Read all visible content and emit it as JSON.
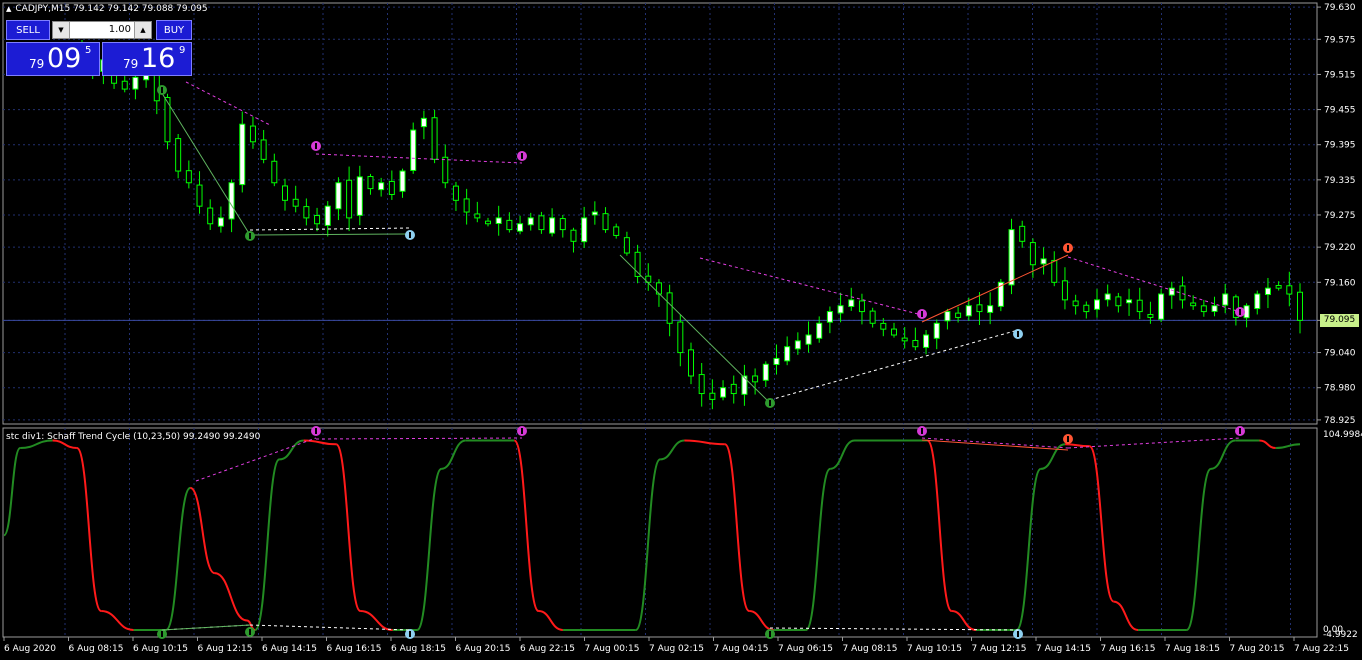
{
  "symbol_header": "CADJPY,M15  79.142 79.142 79.088 79.095",
  "indicator_header": "stc div1: Schaff Trend Cycle (10,23,50) 99.2490 99.2490",
  "trade_panel": {
    "sell_label": "SELL",
    "buy_label": "BUY",
    "lot_value": "1.00",
    "bid_prefix": "79",
    "bid_big": "09",
    "bid_sup": "5",
    "ask_prefix": "79",
    "ask_big": "16",
    "ask_sup": "9"
  },
  "current_price_label": "79.095",
  "colors": {
    "background": "#000000",
    "bull_candle": "#ffffff",
    "bear_candle": "#000000",
    "candle_wick": "#00ff00",
    "grid": "#223070",
    "stc_up": "#228b22",
    "stc_down": "#ff1a1a",
    "divergence_bear": "#e23ee2",
    "divergence_bull": "#ffffff",
    "trendline": "#5fb35f",
    "price_label_bg": "#c8f08a",
    "panel_blue": "#1c1cd4"
  },
  "chart_data": [
    {
      "type": "candlestick",
      "title": "CADJPY,M15",
      "ylim": [
        78.918,
        79.637
      ],
      "yticks": [
        "79.630",
        "79.575",
        "79.515",
        "79.455",
        "79.395",
        "79.335",
        "79.275",
        "79.220",
        "79.160",
        "79.095",
        "79.040",
        "78.980",
        "78.925"
      ],
      "xticks": [
        "6 Aug 2020",
        "6 Aug 08:15",
        "6 Aug 10:15",
        "6 Aug 12:15",
        "6 Aug 14:15",
        "6 Aug 16:15",
        "6 Aug 18:15",
        "6 Aug 20:15",
        "6 Aug 22:15",
        "7 Aug 00:15",
        "7 Aug 02:15",
        "7 Aug 04:15",
        "7 Aug 06:15",
        "7 Aug 08:15",
        "7 Aug 10:15",
        "7 Aug 12:15",
        "7 Aug 14:15",
        "7 Aug 16:15",
        "7 Aug 18:15",
        "7 Aug 20:15",
        "7 Aug 22:15"
      ],
      "current_price": 79.095,
      "close_path": [
        79.55,
        79.52,
        79.54,
        79.5,
        79.49,
        79.51,
        79.53,
        79.47,
        79.4,
        79.35,
        79.33,
        79.29,
        79.26,
        79.27,
        79.33,
        79.43,
        79.4,
        79.37,
        79.33,
        79.3,
        79.29,
        79.27,
        79.26,
        79.29,
        79.33,
        79.27,
        79.34,
        79.32,
        79.33,
        79.31,
        79.35,
        79.42,
        79.44,
        79.37,
        79.33,
        79.3,
        79.28,
        79.27,
        79.26,
        79.27,
        79.25,
        79.26,
        79.27,
        79.25,
        79.27,
        79.25,
        79.23,
        79.27,
        79.28,
        79.25,
        79.24,
        79.21,
        79.17,
        79.16,
        79.14,
        79.09,
        79.04,
        79.0,
        78.97,
        78.96,
        78.98,
        78.97,
        79.0,
        78.99,
        79.02,
        79.03,
        79.05,
        79.06,
        79.07,
        79.09,
        79.11,
        79.12,
        79.13,
        79.11,
        79.09,
        79.08,
        79.07,
        79.06,
        79.05,
        79.07,
        79.09,
        79.11,
        79.1,
        79.12,
        79.11,
        79.12,
        79.16,
        79.25,
        79.23,
        79.19,
        79.2,
        79.16,
        79.13,
        79.12,
        79.11,
        79.13,
        79.14,
        79.12,
        79.13,
        79.11,
        79.1,
        79.14,
        79.15,
        79.13,
        79.12,
        79.11,
        79.12,
        79.14,
        79.1,
        79.12,
        79.14,
        79.15,
        79.15,
        79.14,
        79.095
      ],
      "bearish_divergence_line": [
        [
          79.56,
          79.45
        ],
        [
          79.39,
          79.37
        ],
        [
          79.37,
          79.365
        ],
        [
          79.21,
          79.115
        ],
        [
          79.21,
          79.13
        ]
      ],
      "bullish_divergence_line": [
        [
          79.265,
          79.265
        ],
        [
          78.97,
          79.09
        ]
      ]
    },
    {
      "type": "line",
      "title": "stc div1: Schaff Trend Cycle (10,23,50)",
      "ylim": [
        0,
        104.9984
      ],
      "yticks": [
        "104.9984",
        "0.00",
        "-4.9922"
      ],
      "last_values": [
        99.249,
        99.249
      ],
      "cycle_keypoints": [
        {
          "x": 0,
          "v": 50
        },
        {
          "x": 2,
          "v": 96
        },
        {
          "x": 6,
          "v": 100
        },
        {
          "x": 9,
          "v": 96
        },
        {
          "x": 12,
          "v": 10
        },
        {
          "x": 16,
          "v": 0
        },
        {
          "x": 20,
          "v": 0
        },
        {
          "x": 23,
          "v": 75
        },
        {
          "x": 26,
          "v": 30
        },
        {
          "x": 30,
          "v": 5
        },
        {
          "x": 31,
          "v": 0
        },
        {
          "x": 34,
          "v": 90
        },
        {
          "x": 37,
          "v": 100
        },
        {
          "x": 41,
          "v": 98
        },
        {
          "x": 44,
          "v": 10
        },
        {
          "x": 48,
          "v": 0
        },
        {
          "x": 51,
          "v": 0
        },
        {
          "x": 54,
          "v": 85
        },
        {
          "x": 57,
          "v": 100
        },
        {
          "x": 63,
          "v": 100
        },
        {
          "x": 66,
          "v": 10
        },
        {
          "x": 69,
          "v": 0
        },
        {
          "x": 78,
          "v": 0
        },
        {
          "x": 81,
          "v": 90
        },
        {
          "x": 84,
          "v": 100
        },
        {
          "x": 89,
          "v": 98
        },
        {
          "x": 92,
          "v": 10
        },
        {
          "x": 95,
          "v": 0
        },
        {
          "x": 99,
          "v": 0
        },
        {
          "x": 102,
          "v": 85
        },
        {
          "x": 105,
          "v": 100
        },
        {
          "x": 114,
          "v": 100
        },
        {
          "x": 117,
          "v": 10
        },
        {
          "x": 120,
          "v": 0
        },
        {
          "x": 125,
          "v": 0
        },
        {
          "x": 128,
          "v": 85
        },
        {
          "x": 131,
          "v": 98
        },
        {
          "x": 134,
          "v": 97
        },
        {
          "x": 137,
          "v": 15
        },
        {
          "x": 140,
          "v": 0
        },
        {
          "x": 146,
          "v": 0
        },
        {
          "x": 149,
          "v": 85
        },
        {
          "x": 152,
          "v": 100
        },
        {
          "x": 155,
          "v": 100
        },
        {
          "x": 157,
          "v": 96
        },
        {
          "x": 160,
          "v": 98
        }
      ]
    }
  ]
}
